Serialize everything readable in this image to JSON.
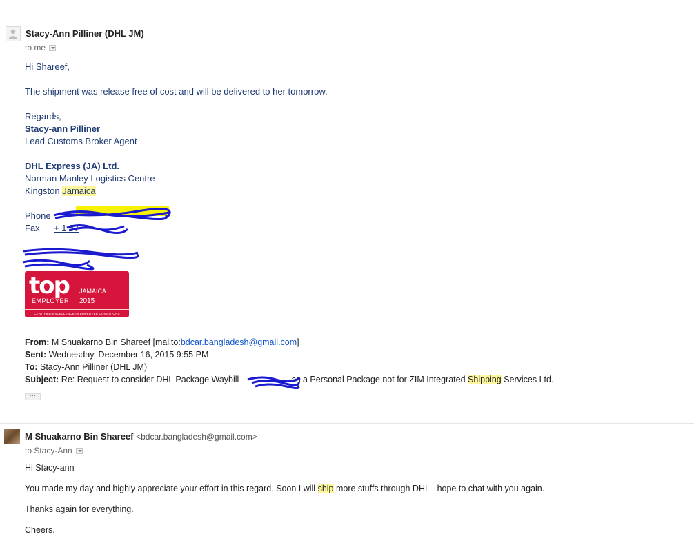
{
  "message1": {
    "sender_name": "Stacy-Ann Pilliner (DHL JM)",
    "recipient": "to me",
    "greeting": "Hi Shareef,",
    "body": "The shipment was release free of cost and will be delivered to her tomorrow.",
    "signature": {
      "closing": "Regards,",
      "name": "Stacy-ann Pilliner",
      "title": "Lead Customs Broker Agent",
      "company": "DHL Express (JA) Ltd.",
      "address1": "Norman Manley Logistics Centre",
      "address2_city": "Kingston",
      "address2_country": "Jamaica",
      "phone_label": "Phone",
      "fax_label": "Fax",
      "fax_visible_prefix": "+ 1 87"
    },
    "logo": {
      "word": "top",
      "employer": "EMPLOYER",
      "country": "JAMAICA",
      "year": "2015",
      "certified": "CERTIFIED EXCELLENCE IN EMPLOYEE CONDITIONS"
    },
    "quoted": {
      "from_label": "From:",
      "from_value": "M Shuakarno Bin Shareef [mailto:",
      "from_email": "bdcar.bangladesh@gmail.com",
      "from_close": "]",
      "sent_label": "Sent:",
      "sent_value": "Wednesday, December 16, 2015 9:55 PM",
      "to_label": "To:",
      "to_value": "Stacy-Ann Pilliner (DHL JM)",
      "subject_label": "Subject:",
      "subject_part1": "Re: Request to consider DHL Package Waybill",
      "subject_part2": "as a Personal Package not for ZIM Integrated",
      "subject_highlight": "Shipping",
      "subject_part3": "Services Ltd."
    },
    "ellipsis": "···"
  },
  "message2": {
    "sender_name": "M Shuakarno Bin Shareef",
    "sender_email": "<bdcar.bangladesh@gmail.com>",
    "recipient": "to Stacy-Ann",
    "greeting": "Hi Stacy-ann",
    "body_part1": "You made my day and highly appreciate your effort in this regard. Soon I will",
    "body_highlight": "ship",
    "body_part2": "more stuffs through DHL - hope to chat with you again.",
    "thanks": "Thanks again for everything.",
    "closing": "Cheers."
  },
  "colors": {
    "signature_text": "#1f3b73",
    "highlight": "#fff79e",
    "redaction": "#1a1acf",
    "logo_red": "#d5153b"
  }
}
